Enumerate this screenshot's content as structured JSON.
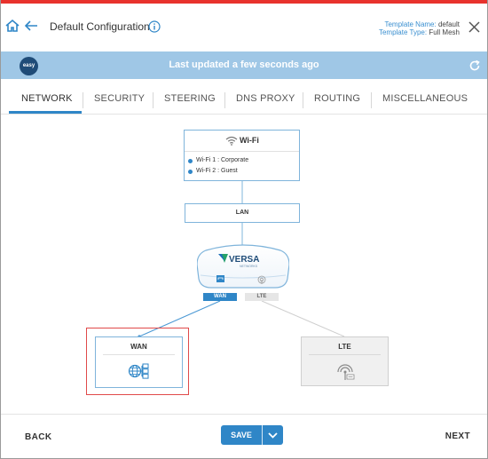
{
  "header": {
    "title": "Default Configuration",
    "template_name_label": "Template Name:",
    "template_name": "default",
    "template_type_label": "Template Type:",
    "template_type": "Full Mesh",
    "icons": [
      "home-icon",
      "back-arrow-icon",
      "info-icon",
      "close-icon"
    ]
  },
  "status_bar": {
    "badge": "easy",
    "text": "Last updated a few seconds ago",
    "icon": "refresh-icon"
  },
  "tabs": [
    {
      "label": "NETWORK",
      "active": true
    },
    {
      "label": "SECURITY",
      "active": false
    },
    {
      "label": "STEERING",
      "active": false
    },
    {
      "label": "DNS PROXY",
      "active": false
    },
    {
      "label": "ROUTING",
      "active": false
    },
    {
      "label": "MISCELLANEOUS",
      "active": false
    }
  ],
  "diagram": {
    "wifi": {
      "title": "Wi-Fi",
      "items": [
        "Wi-Fi 1 : Corporate",
        "Wi-Fi 2 : Guest"
      ]
    },
    "lan": {
      "title": "LAN"
    },
    "router": {
      "brand": "VERSA",
      "sub": "NETWORKS"
    },
    "ports": {
      "wan": "WAN",
      "lte": "LTE"
    },
    "wan_node": {
      "title": "WAN",
      "icon": "globe-network-icon",
      "selected": true
    },
    "lte_node": {
      "title": "LTE",
      "icon": "antenna-icon"
    },
    "colors": {
      "accent": "#2f86c7",
      "line": "#7fb4db",
      "selection": "#e04a4a",
      "top_accent": "#e8322d"
    }
  },
  "footer": {
    "back": "BACK",
    "save": "SAVE",
    "next": "NEXT"
  }
}
